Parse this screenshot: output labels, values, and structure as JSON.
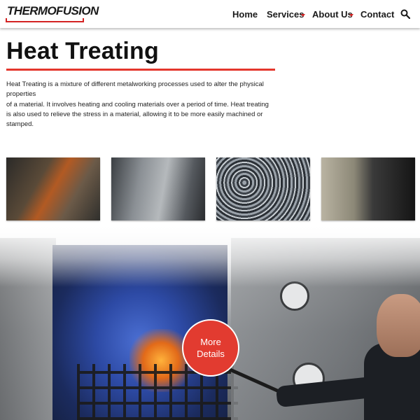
{
  "header": {
    "logo_text": "THERMOFUSION",
    "nav": [
      {
        "label": "Home"
      },
      {
        "label": "Services",
        "has_dropdown": true
      },
      {
        "label": "About Us",
        "has_dropdown": true
      },
      {
        "label": "Contact"
      }
    ],
    "search_icon": "search-icon",
    "accent_color": "#d32222"
  },
  "main": {
    "title": "Heat Treating",
    "intro_lines": [
      "Heat Treating is a mixture of different metalworking processes used to alter the physical properties",
      "of a material. It involves heating and cooling materials over a period of time. Heat treating",
      "is also used to relieve the stress in a material, allowing it to be more easily machined or stamped."
    ],
    "rule_color": "#e4372d"
  },
  "gallery": {
    "photos": [
      "worker-at-furnace-photo",
      "vacuum-furnace-photo",
      "metal-parts-photo",
      "hardness-testing-photo"
    ]
  },
  "hero": {
    "button_label": "More Details",
    "button_color": "#e23b30"
  }
}
